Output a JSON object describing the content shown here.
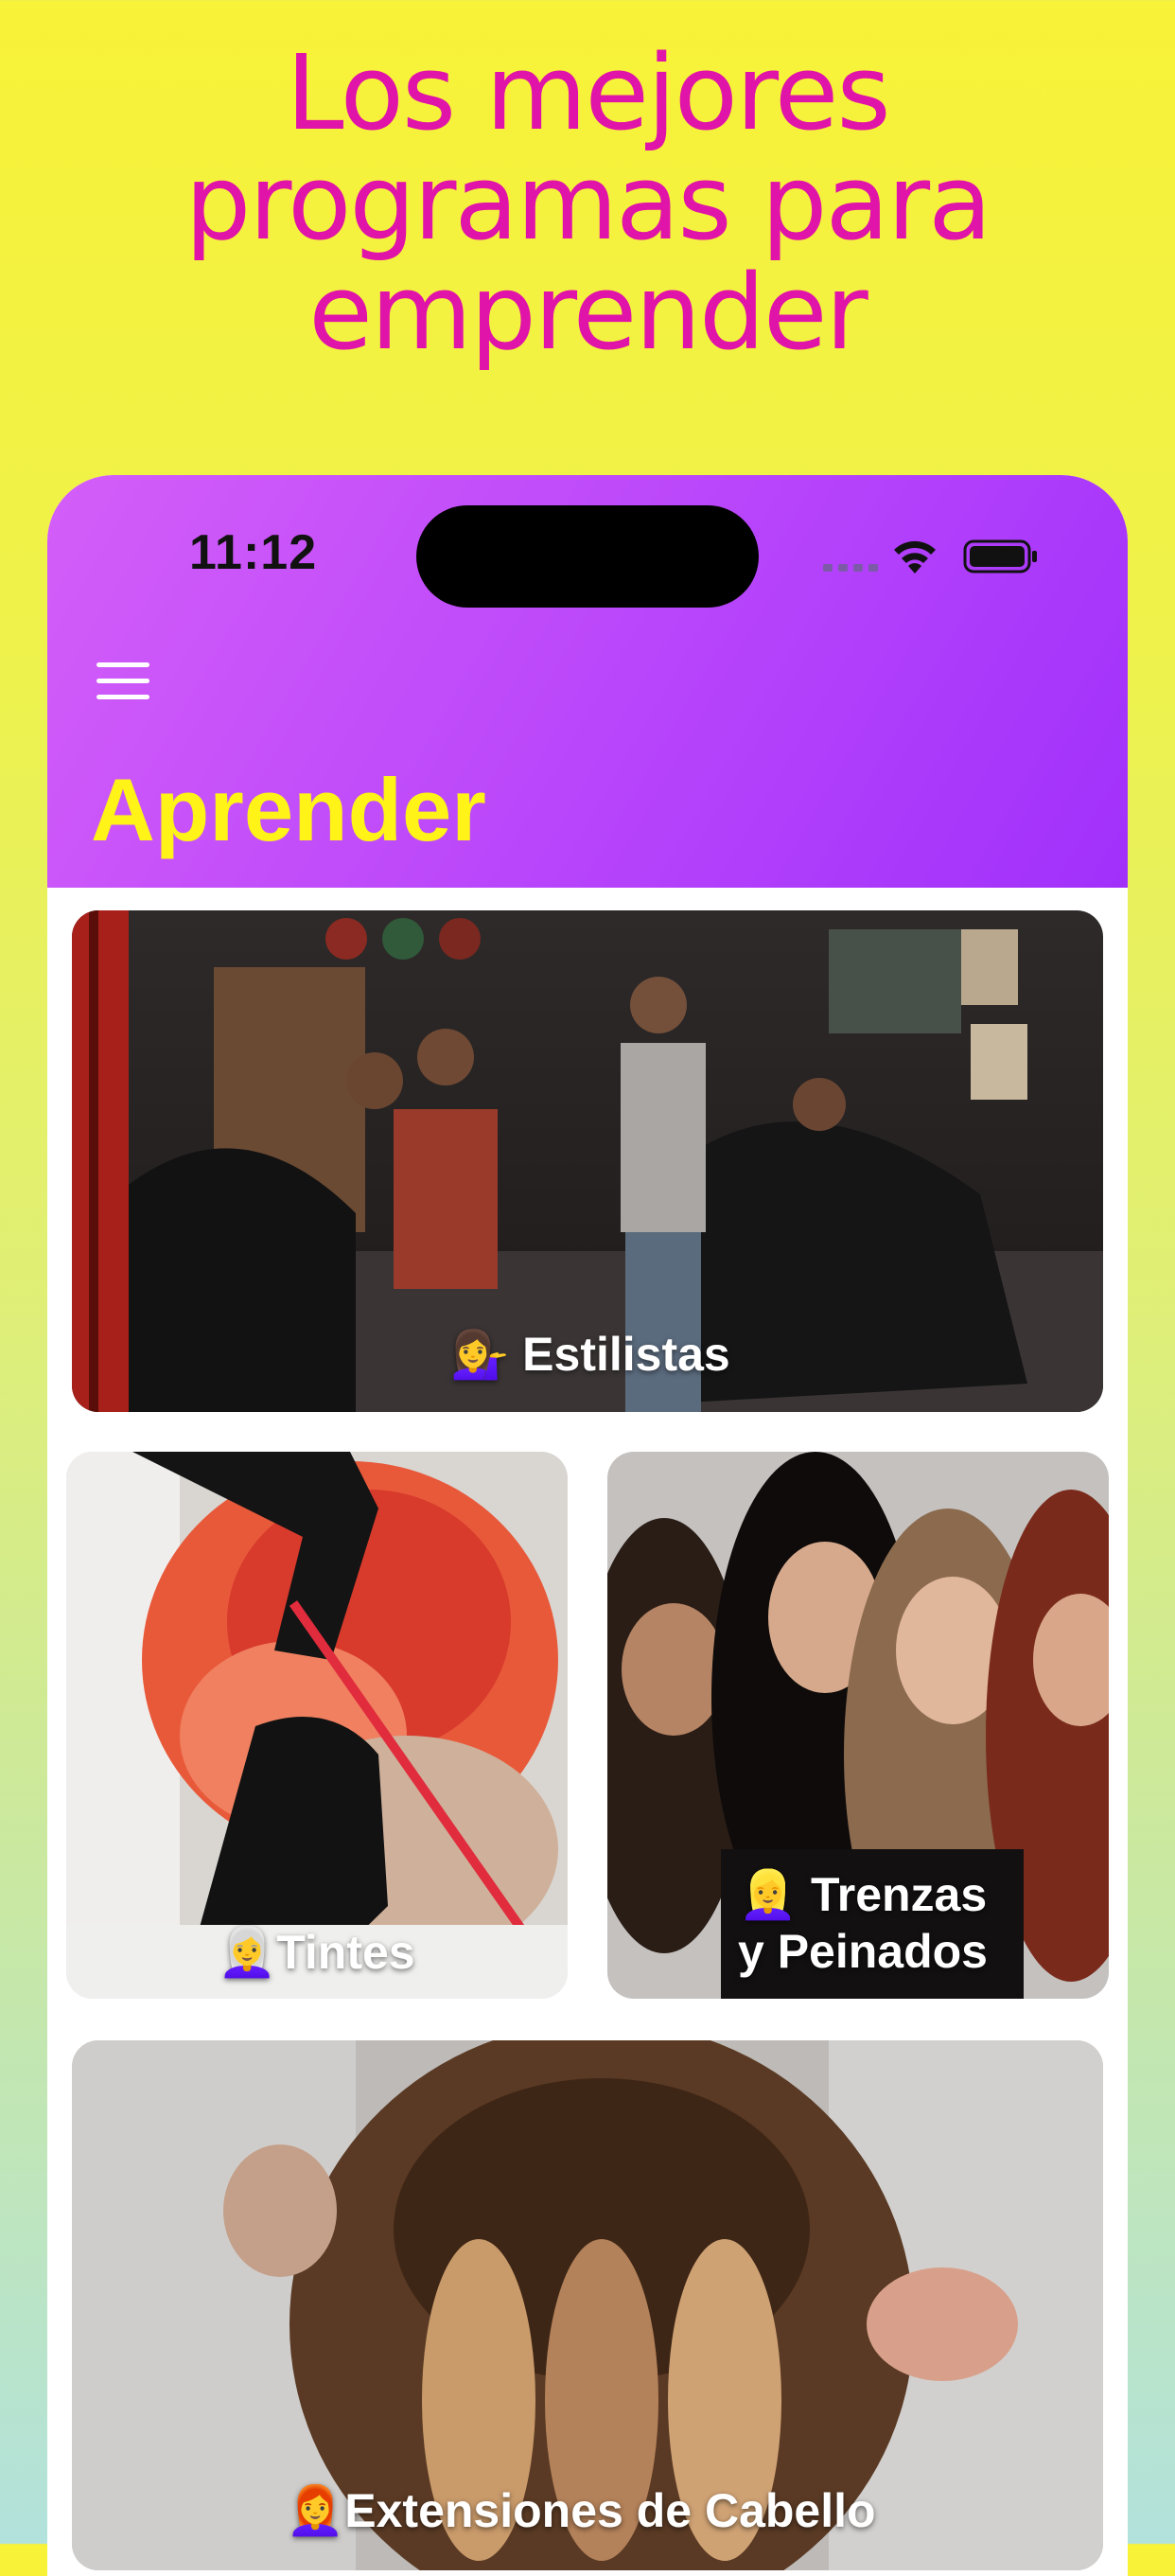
{
  "headline": {
    "line1": "Los mejores",
    "line2": "programas para",
    "line3": "emprender"
  },
  "status_bar": {
    "time": "11:12",
    "icons": [
      "signal-icon",
      "wifi-icon",
      "battery-icon"
    ]
  },
  "app": {
    "menu_icon": "hamburger-menu-icon",
    "title": "Aprender"
  },
  "cards": [
    {
      "emoji": "💁‍♀️",
      "label": "Estilistas"
    },
    {
      "emoji": "👩‍🦳",
      "label": "Tintes"
    },
    {
      "emoji": "👱‍♀️",
      "label": "Trenzas",
      "label_line2": "y Peinados"
    },
    {
      "emoji": "👩‍🦰",
      "label": "Extensiones de Cabello"
    }
  ],
  "colors": {
    "headline": "#e014a8",
    "header_gradient_start": "#d45ef8",
    "header_gradient_end": "#a130fb",
    "title": "#fff318"
  }
}
